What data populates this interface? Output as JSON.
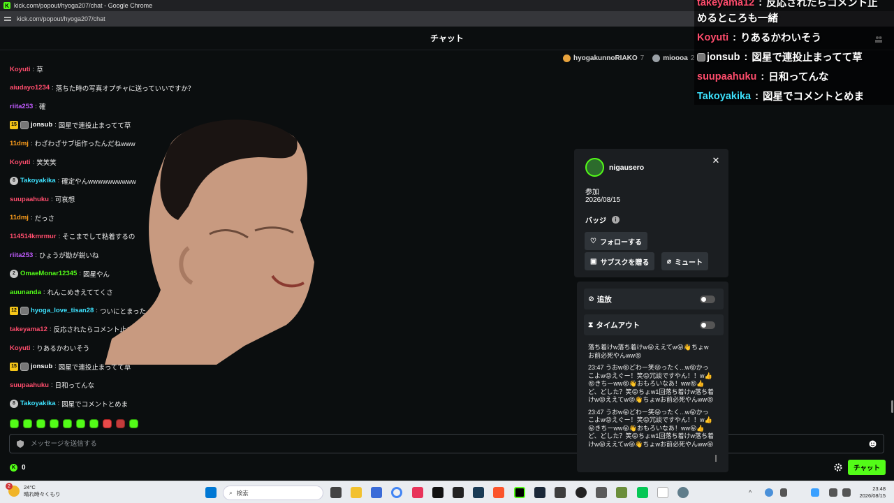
{
  "window": {
    "title": "kick.com/popout/hyoga207/chat - Google Chrome",
    "url": "kick.com/popout/hyoga207/chat"
  },
  "chat": {
    "title": "チャット",
    "leaderboard": [
      {
        "name": "hyogakunnoRIAKO",
        "count": "7",
        "color": "#e8a33d"
      },
      {
        "name": "mioooa",
        "count": "2",
        "color": "#9aa0a6"
      }
    ],
    "messages": [
      {
        "user": "Koyuti",
        "color": "#ff4d6d",
        "text": "草"
      },
      {
        "user": "aiudayo1234",
        "color": "#ff4d6d",
        "text": "落ちた時の写真オプチャに送っていいですか？"
      },
      {
        "user": "riita253",
        "color": "#c15cff",
        "text": "確"
      },
      {
        "user": "jonsub",
        "color": "#ffffff",
        "text": "図星で連投止まってて草",
        "sub": "15"
      },
      {
        "user": "11dmj",
        "color": "#ff9f1c",
        "text": "わざわざサブ垢作ったんだねwww"
      },
      {
        "user": "Koyuti",
        "color": "#ff4d6d",
        "text": "笑笑笑"
      },
      {
        "user": "Takoyakika",
        "color": "#3ee3ff",
        "text": "確定やんwwwwwwwwww",
        "circle": "8"
      },
      {
        "user": "suupaahuku",
        "color": "#ff4d6d",
        "text": "可哀想"
      },
      {
        "user": "11dmj",
        "color": "#ff9f1c",
        "text": "だっさ"
      },
      {
        "user": "114514kmrmur",
        "color": "#ff4d6d",
        "text": "そこまでして粘着するの"
      },
      {
        "user": "riita253",
        "color": "#c15cff",
        "text": "ひょうが勘が鋭いね"
      },
      {
        "user": "OmaeMonar12345",
        "color": "#53fc18",
        "text": "図星やん",
        "circle": "2"
      },
      {
        "user": "auunanda",
        "color": "#53fc18",
        "text": "れんこめきえててくさ"
      },
      {
        "user": "hyoga_love_tisan28",
        "color": "#3ee3ff",
        "text": "ついにとまった",
        "sub": "12"
      },
      {
        "user": "takeyama12",
        "color": "#ff4d6d",
        "text": "反応されたらコメント止めるところ"
      },
      {
        "user": "Koyuti",
        "color": "#ff4d6d",
        "text": "りあるかわいそう"
      },
      {
        "user": "jonsub",
        "color": "#ffffff",
        "text": "図星で連投止まってて草",
        "sub": "15"
      },
      {
        "user": "suupaahuku",
        "color": "#ff4d6d",
        "text": "日和ってんな"
      },
      {
        "user": "Takoyakika",
        "color": "#3ee3ff",
        "text": "図星でコメントとめま",
        "circle": "8"
      }
    ],
    "input_placeholder": "メッセージを送信する",
    "points": "0",
    "send_label": "チャット"
  },
  "overlay": {
    "lines": [
      {
        "user": "takeyama12",
        "color": "#ff4d6d",
        "text": "反応されたらコメント止"
      },
      {
        "user": "",
        "color": "#ffffff",
        "text": "めるところも一緒"
      },
      {
        "user": "Koyuti",
        "color": "#ff4d6d",
        "text": "りあるかわいそう"
      },
      {
        "user": "jonsub",
        "color": "#ffffff",
        "text": "図星で連投止まってて草"
      },
      {
        "user": "suupaahuku",
        "color": "#ff4d6d",
        "text": "日和ってんな"
      },
      {
        "user": "Takoyakika",
        "color": "#3ee3ff",
        "text": "図星でコメントとめま"
      }
    ]
  },
  "popup": {
    "username": "nigausero",
    "join_label": "参加",
    "join_date": "2026/08/15",
    "badges_label": "バッジ",
    "follow_label": "フォローする",
    "gift_label": "サブスクを贈る",
    "mute_label": "ミュート"
  },
  "mod": {
    "ban_label": "追放",
    "timeout_label": "タイムアウト",
    "log": [
      "落ち着けw落ち着けw😝ええてw😝👋ちょwお前必死やんww😝",
      "23:47 うおw😝どわー笑😝ったく...w😝かっこよw😝えぐー！笑😝冗談ですやん！！w👍😝きちーww😝👋おもろいなあ！ww😝👍ど、どした？笑😝ちょw1回落ち着けw落ち着けw😝ええてw😝👋ちょwお前必死やんww😝",
      "23:47 うおw😝どわー笑😝ったく...w😝かっこよw😝えぐー！笑😝冗談ですやん！！w👍😝きちーww😝👋おもろいなあ！ww😝👍ど、どした？笑😝ちょw1回落ち着けw落ち着けw😝ええてw😝👋ちょwお前必死やんww😝"
    ]
  },
  "taskbar": {
    "weather_badge": "2",
    "temperature": "24°C",
    "weather": "晴れ時々くもり",
    "search_placeholder": "検索",
    "time": "23:48",
    "date": "2026/08/15"
  }
}
